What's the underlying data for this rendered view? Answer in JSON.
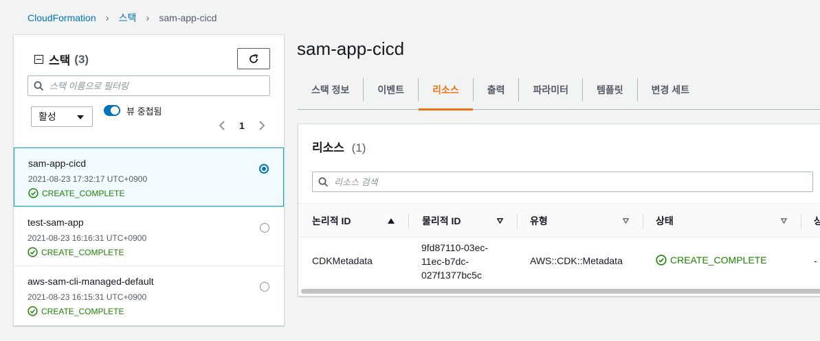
{
  "breadcrumb": {
    "root": "CloudFormation",
    "stacks": "스택",
    "current": "sam-app-cicd"
  },
  "left_panel": {
    "title": "스택",
    "count": "(3)",
    "search_placeholder": "스택 이름으로 필터링",
    "filter_select": "활성",
    "toggle_label": "뷰 중첩됨",
    "page": "1",
    "stacks": [
      {
        "name": "sam-app-cicd",
        "date": "2021-08-23 17:32:17 UTC+0900",
        "status": "CREATE_COMPLETE",
        "selected": true
      },
      {
        "name": "test-sam-app",
        "date": "2021-08-23 16:16:31 UTC+0900",
        "status": "CREATE_COMPLETE",
        "selected": false
      },
      {
        "name": "aws-sam-cli-managed-default",
        "date": "2021-08-23 16:15:31 UTC+0900",
        "status": "CREATE_COMPLETE",
        "selected": false
      }
    ]
  },
  "main": {
    "title": "sam-app-cicd",
    "tabs": [
      "스택 정보",
      "이벤트",
      "리소스",
      "출력",
      "파라미터",
      "템플릿",
      "변경 세트"
    ],
    "active_tab": "리소스"
  },
  "resources": {
    "title": "리소스",
    "count": "(1)",
    "search_placeholder": "리소스 검색",
    "columns": [
      "논리적 ID",
      "물리적 ID",
      "유형",
      "상태",
      "상"
    ],
    "rows": [
      {
        "logical_id": "CDKMetadata",
        "physical_id_lines": [
          "9fd87110-03ec-",
          "11ec-b7dc-",
          "027f1377bc5c"
        ],
        "type": "AWS::CDK::Metadata",
        "status": "CREATE_COMPLETE",
        "extra": "-"
      }
    ]
  },
  "colors": {
    "accent": "#0073bb",
    "success": "#1d8102",
    "active_tab": "#ec7211"
  }
}
